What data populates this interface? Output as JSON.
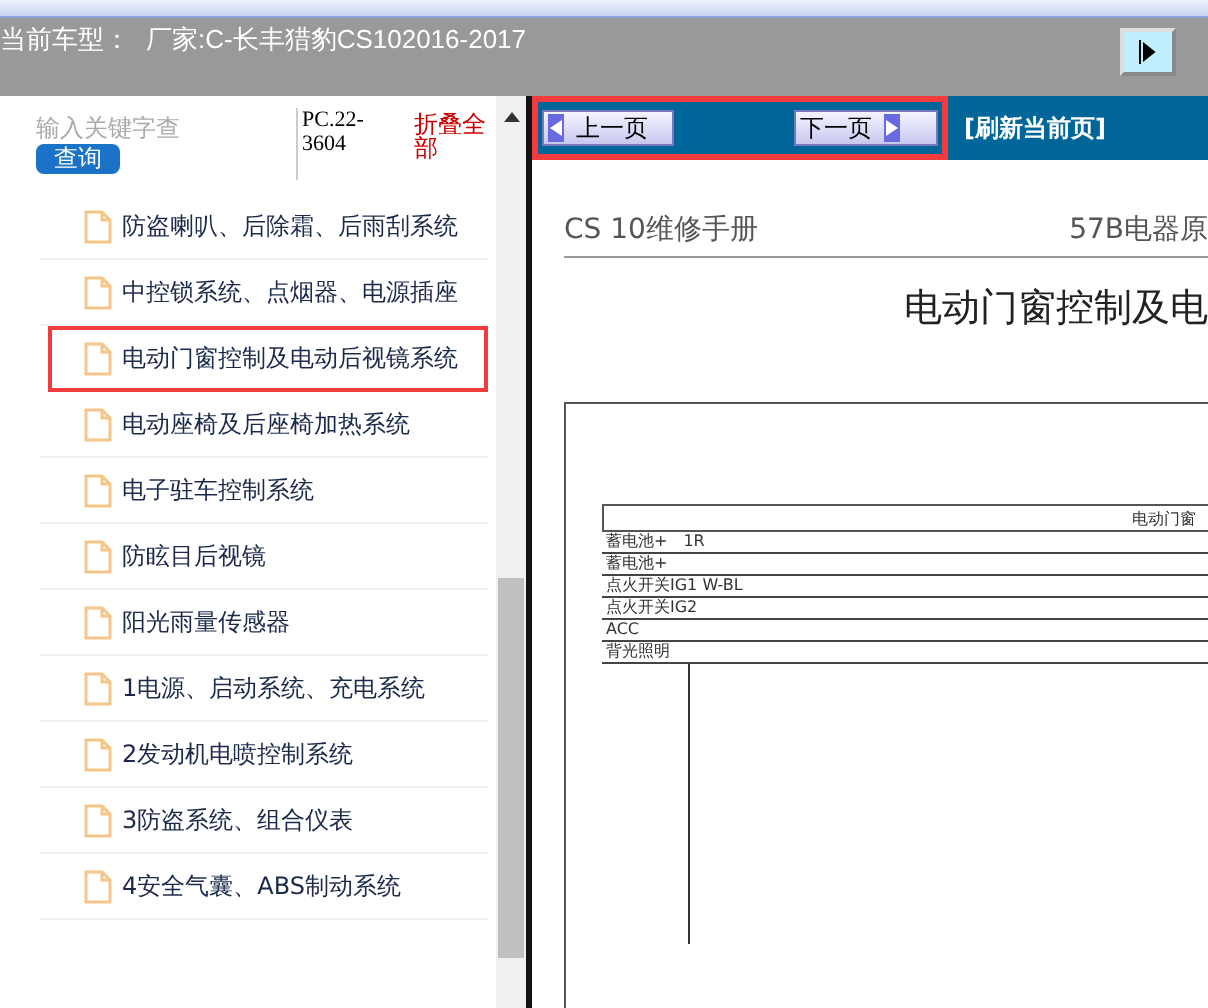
{
  "header": {
    "model_label": "当前车型：",
    "model_value": "厂家:C-长丰猎豹CS102016-2017"
  },
  "search": {
    "placeholder": "输入关键字查",
    "button": "查询",
    "code": "PC.22-3604",
    "collapse": "折叠全部"
  },
  "items": [
    {
      "label": "防盗喇叭、后除霜、后雨刮系统",
      "selected": false
    },
    {
      "label": "中控锁系统、点烟器、电源插座",
      "selected": false
    },
    {
      "label": "电动门窗控制及电动后视镜系统",
      "selected": true
    },
    {
      "label": "电动座椅及后座椅加热系统",
      "selected": false
    },
    {
      "label": "电子驻车控制系统",
      "selected": false
    },
    {
      "label": "防眩目后视镜",
      "selected": false
    },
    {
      "label": "阳光雨量传感器",
      "selected": false
    },
    {
      "label": "1电源、启动系统、充电系统",
      "selected": false
    },
    {
      "label": "2发动机电喷控制系统",
      "selected": false
    },
    {
      "label": "3防盗系统、组合仪表",
      "selected": false
    },
    {
      "label": "4安全气囊、ABS制动系统",
      "selected": false
    }
  ],
  "nav": {
    "prev": "上一页",
    "next": "下一页",
    "refresh": "[刷新当前页]"
  },
  "document": {
    "manual": "CS 10维修手册",
    "section": "57B电器原",
    "title": "电动门窗控制及电",
    "diagram_title": "电动门窗",
    "rails": [
      "蓄电池+　1R",
      "蓄电池+",
      "点火开关IG1 W-BL",
      "点火开关IG2",
      "ACC",
      "背光照明"
    ]
  }
}
